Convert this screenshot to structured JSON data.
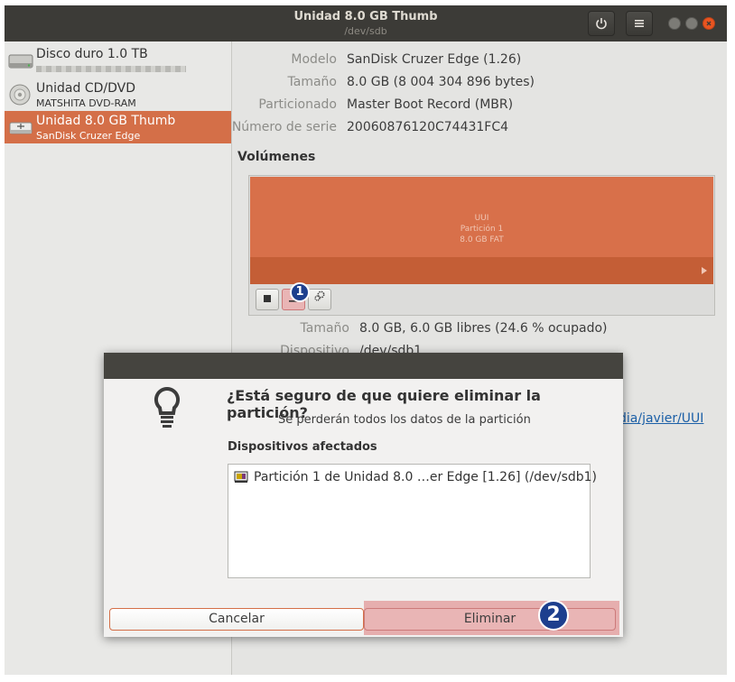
{
  "window": {
    "title": "Unidad 8.0 GB Thumb",
    "subtitle": "/dev/sdb",
    "power_icon": "power-icon",
    "menu_icon": "hamburger-menu-icon"
  },
  "sidebar": {
    "items": [
      {
        "name": "Disco duro 1.0 TB",
        "sub": "",
        "icon": "hard-disk-icon"
      },
      {
        "name": "Unidad CD/DVD",
        "sub": "MATSHITA DVD-RAM",
        "icon": "optical-disc-icon"
      },
      {
        "name": "Unidad 8.0 GB Thumb",
        "sub": "SanDisk Cruzer Edge",
        "icon": "usb-drive-icon",
        "selected": true
      }
    ]
  },
  "drive": {
    "labels": {
      "model": "Modelo",
      "size": "Tamaño",
      "partitioning": "Particionado",
      "serial": "Número de serie"
    },
    "values": {
      "model": "SanDisk Cruzer Edge (1.26)",
      "size": "8.0 GB (8 004 304 896 bytes)",
      "partitioning": "Master Boot Record (MBR)",
      "serial": "20060876120C74431FC4"
    }
  },
  "volumes": {
    "heading": "Volúmenes",
    "partition": {
      "label": "UUI",
      "name": "Partición 1",
      "info": "8.0 GB FAT"
    },
    "details": {
      "size_label": "Tamaño",
      "size_value": "8.0 GB, 6.0 GB libres (24.6 % ocupado)",
      "device_label": "Dispositivo",
      "device_value": "/dev/sdb1",
      "link_tail": "dia/javier/UUI"
    }
  },
  "dialog": {
    "question": "¿Está seguro de que quiere eliminar la partición?",
    "warning": "Se perderán todos los datos de la partición",
    "affected_heading": "Dispositivos afectados",
    "affected_items": [
      "Partición 1 de Unidad 8.0 …er Edge [1.26] (/dev/sdb1)"
    ],
    "cancel_label": "Cancelar",
    "delete_label": "Eliminar"
  },
  "annotations": {
    "step1": "1",
    "step2": "2"
  },
  "colors": {
    "accent": "#d46f48",
    "titlebar": "#3c3b37",
    "badge": "#1d3f8e"
  }
}
